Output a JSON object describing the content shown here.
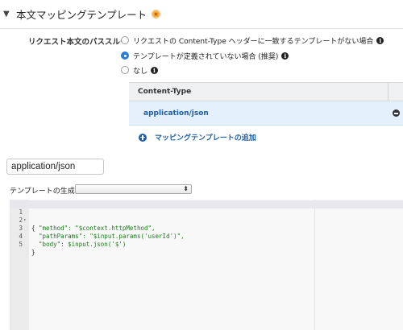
{
  "section": {
    "title": "本文マッピングテンプレート",
    "caret": "▼"
  },
  "passthrough": {
    "label": "リクエスト本文のパススルー",
    "options": [
      {
        "label": "リクエストの Content-Type ヘッダーに一致するテンプレートがない場合",
        "selected": false
      },
      {
        "label": "テンプレートが定義されていない場合 (推奨)",
        "selected": true
      },
      {
        "label": "なし",
        "selected": false
      }
    ]
  },
  "content_type_table": {
    "header": "Content-Type",
    "rows": [
      "application/json"
    ]
  },
  "add_template_link": "マッピングテンプレートの追加",
  "content_type_input": {
    "value": "application/json"
  },
  "template_generation": {
    "label": "テンプレートの生成:",
    "selected": ""
  },
  "editor": {
    "lines": [
      {
        "num": "1",
        "text": "{"
      },
      {
        "num": "2",
        "text": "  \"method\": \"$context.httpMethod\","
      },
      {
        "num": "3",
        "text": "  \"pathParams\": \"$input.params('userId')\","
      },
      {
        "num": "4",
        "text": "  \"body\": $input.json('$')"
      },
      {
        "num": "5",
        "text": "}"
      }
    ]
  },
  "colors": {
    "accent_blue": "#1c5ea8",
    "selected_row_bg": "#e4f0fb",
    "warning_orange": "#f0a030"
  }
}
